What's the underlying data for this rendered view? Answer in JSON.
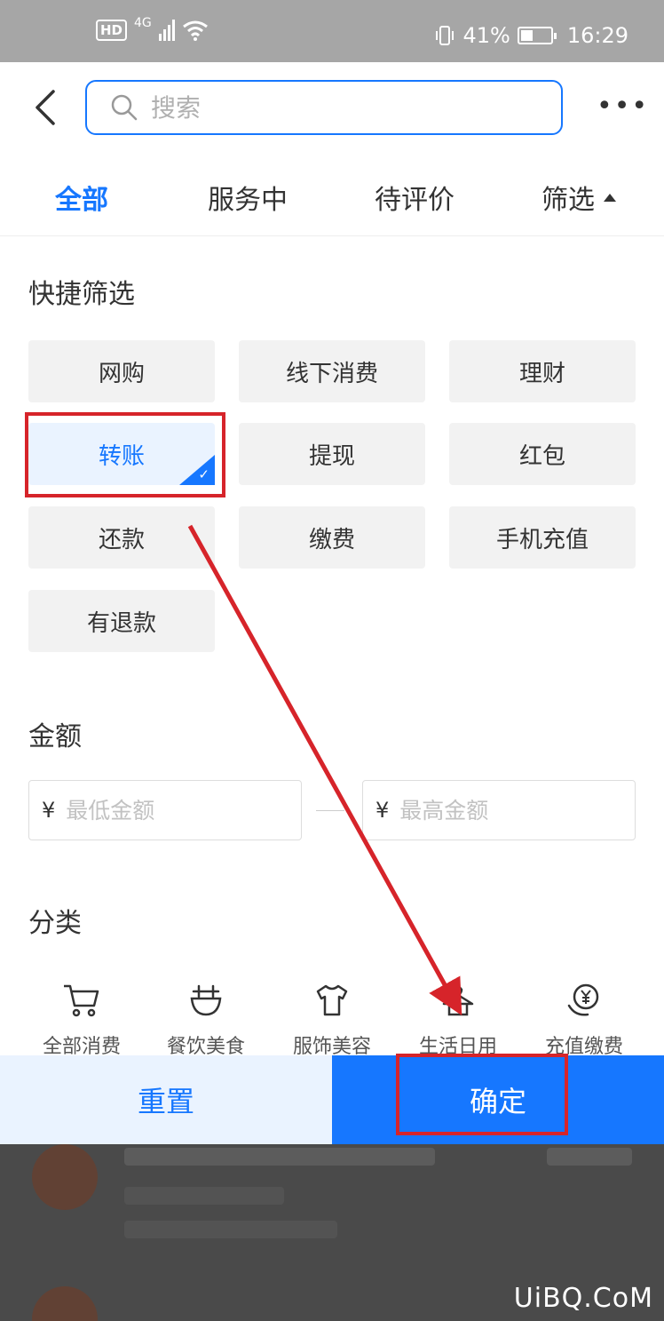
{
  "status_bar": {
    "network": "4G",
    "hd": "HD",
    "battery": "41%",
    "battery_level": 0.41,
    "time": "16:29"
  },
  "header": {
    "search_placeholder": "搜索",
    "more": "•••"
  },
  "tabs": [
    "全部",
    "服务中",
    "待评价",
    "筛选"
  ],
  "quick_filter": {
    "title": "快捷筛选",
    "chips": [
      "网购",
      "线下消费",
      "理财",
      "转账",
      "提现",
      "红包",
      "还款",
      "缴费",
      "手机充值",
      "有退款"
    ],
    "selected": "转账"
  },
  "amount": {
    "title": "金额",
    "currency": "¥",
    "min_placeholder": "最低金额",
    "max_placeholder": "最高金额"
  },
  "category": {
    "title": "分类",
    "items": [
      {
        "label": "全部消费",
        "icon": "cart-icon"
      },
      {
        "label": "餐饮美食",
        "icon": "bowl-icon"
      },
      {
        "label": "服饰美容",
        "icon": "shirt-icon"
      },
      {
        "label": "生活日用",
        "icon": "hanger-icon"
      },
      {
        "label": "充值缴费",
        "icon": "yuan-coin-icon"
      }
    ]
  },
  "buttons": {
    "reset": "重置",
    "confirm": "确定"
  },
  "colors": {
    "accent": "#1677ff",
    "annotation": "#d6242a",
    "status_bar": "#a6a6a6"
  },
  "watermark": "UiBQ.CoM"
}
